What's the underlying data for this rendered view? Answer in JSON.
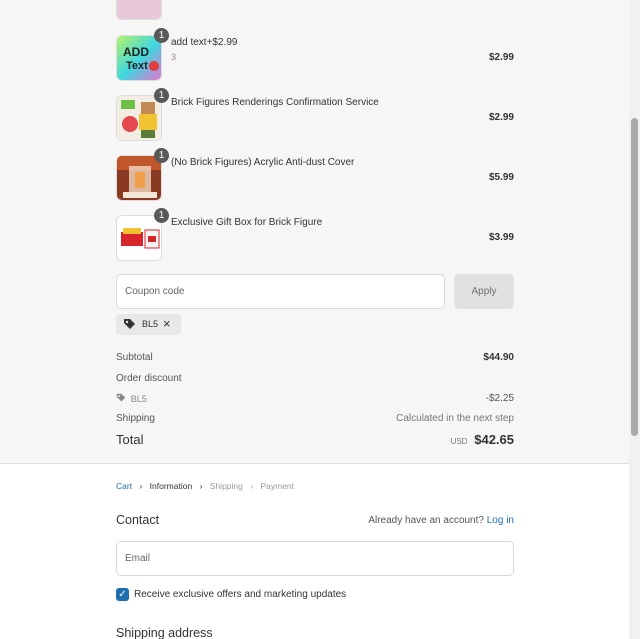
{
  "summary": {
    "items": [
      {
        "title": "add text+$2.99",
        "subtitle": "3",
        "price": "$2.99",
        "qty": "1"
      },
      {
        "title": "Brick Figures Renderings Confirmation Service",
        "subtitle": "",
        "price": "$2.99",
        "qty": "1"
      },
      {
        "title": "(No Brick Figures) Acrylic Anti-dust Cover",
        "subtitle": "",
        "price": "$5.99",
        "qty": "1"
      },
      {
        "title": "Exclusive Gift Box for Brick Figure",
        "subtitle": "",
        "price": "$3.99",
        "qty": "1"
      }
    ],
    "coupon_placeholder": "Coupon code",
    "apply_label": "Apply",
    "applied_code": "BL5",
    "subtotal_label": "Subtotal",
    "subtotal_value": "$44.90",
    "order_discount_label": "Order discount",
    "discount_code": "BL5",
    "discount_value": "-$2.25",
    "shipping_label": "Shipping",
    "shipping_value": "Calculated in the next step",
    "total_label": "Total",
    "total_currency": "USD",
    "total_value": "$42.65"
  },
  "breadcrumb": {
    "cart": "Cart",
    "information": "Information",
    "shipping": "Shipping",
    "payment": "Payment"
  },
  "contact": {
    "title": "Contact",
    "account_prompt": "Already have an account?",
    "login_link": "Log in",
    "email_placeholder": "Email",
    "marketing_label": "Receive exclusive offers and marketing updates"
  },
  "shipping_address": {
    "title": "Shipping address"
  },
  "colors": {
    "accent": "#1f6fb0",
    "summary_bg": "#f6f6f6",
    "qty_badge": "#595959"
  }
}
